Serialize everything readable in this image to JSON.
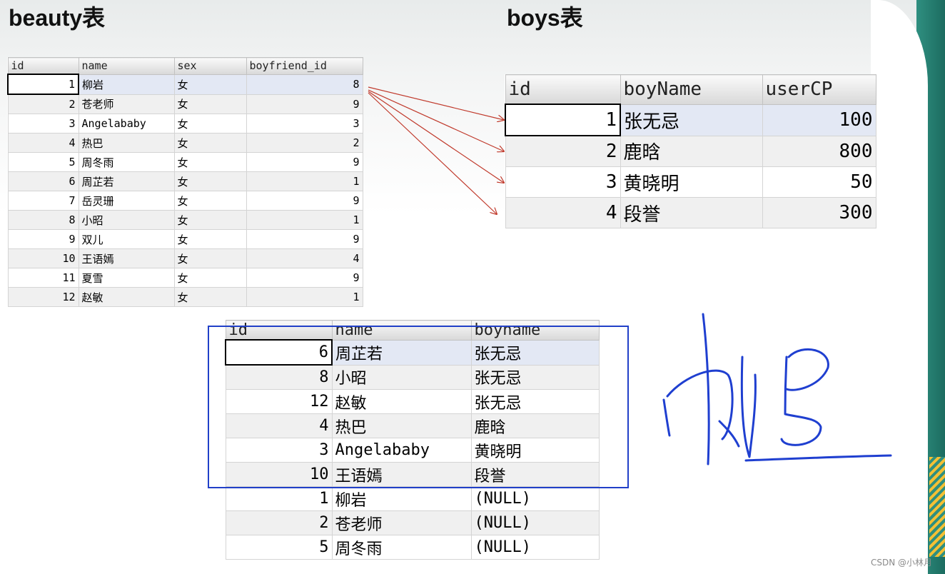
{
  "beauty": {
    "title": "beauty表",
    "columns": [
      "id",
      "name",
      "sex",
      "boyfriend_id"
    ],
    "rows": [
      [
        "1",
        "柳岩",
        "女",
        "8"
      ],
      [
        "2",
        "苍老师",
        "女",
        "9"
      ],
      [
        "3",
        "Angelababy",
        "女",
        "3"
      ],
      [
        "4",
        "热巴",
        "女",
        "2"
      ],
      [
        "5",
        "周冬雨",
        "女",
        "9"
      ],
      [
        "6",
        "周芷若",
        "女",
        "1"
      ],
      [
        "7",
        "岳灵珊",
        "女",
        "9"
      ],
      [
        "8",
        "小昭",
        "女",
        "1"
      ],
      [
        "9",
        "双儿",
        "女",
        "9"
      ],
      [
        "10",
        "王语嫣",
        "女",
        "4"
      ],
      [
        "11",
        "夏雪",
        "女",
        "9"
      ],
      [
        "12",
        "赵敏",
        "女",
        "1"
      ]
    ]
  },
  "boys": {
    "title": "boys表",
    "columns": [
      "id",
      "boyName",
      "userCP"
    ],
    "rows": [
      [
        "1",
        "张无忌",
        "100"
      ],
      [
        "2",
        "鹿晗",
        "800"
      ],
      [
        "3",
        "黄晓明",
        "50"
      ],
      [
        "4",
        "段誉",
        "300"
      ]
    ]
  },
  "result": {
    "columns": [
      "id",
      "name",
      "boyname"
    ],
    "rows": [
      [
        "6",
        "周芷若",
        "张无忌"
      ],
      [
        "8",
        "小昭",
        "张无忌"
      ],
      [
        "12",
        "赵敏",
        "张无忌"
      ],
      [
        "4",
        "热巴",
        "鹿晗"
      ],
      [
        "3",
        "Angelababy",
        "黄晓明"
      ],
      [
        "10",
        "王语嫣",
        "段誉"
      ],
      [
        "1",
        "柳岩",
        "(NULL)"
      ],
      [
        "2",
        "苍老师",
        "(NULL)"
      ],
      [
        "5",
        "周冬雨",
        "(NULL)"
      ]
    ]
  },
  "annotation": {
    "ink_color": "#1f3fd0",
    "box_color": "#2140c8",
    "arrow_color": "#c0392b"
  },
  "watermark": "CSDN @小林月"
}
